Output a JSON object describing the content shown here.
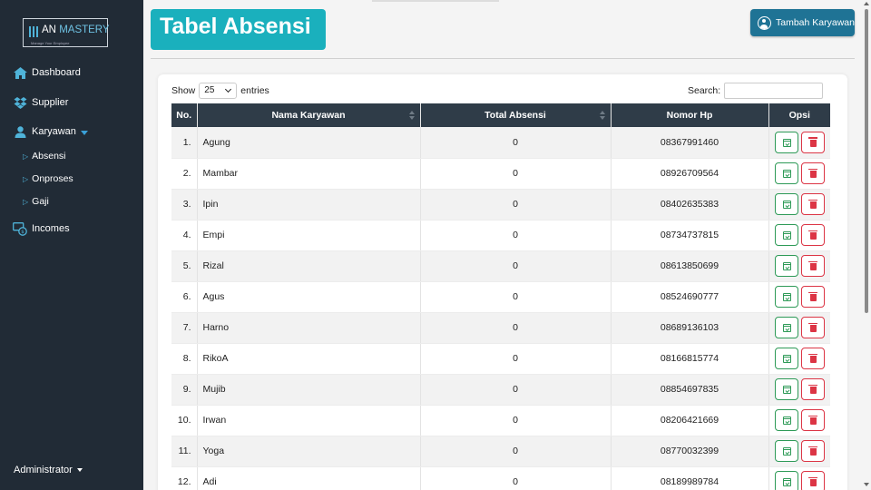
{
  "brand": {
    "name_main": "AN",
    "name_accent": "MASTERY",
    "tagline": "Manage Your Employee"
  },
  "sidebar": {
    "items": [
      {
        "label": "Dashboard",
        "icon": "home-icon"
      },
      {
        "label": "Supplier",
        "icon": "dropbox-icon"
      },
      {
        "label": "Karyawan",
        "icon": "user-icon"
      },
      {
        "label": "Incomes",
        "icon": "money-icon"
      }
    ],
    "sub_items": [
      {
        "label": "Absensi"
      },
      {
        "label": "Onproses"
      },
      {
        "label": "Gaji"
      }
    ],
    "user": "Administrator"
  },
  "header": {
    "title": "Tabel Absensi",
    "add_button": "Tambah Karyawan"
  },
  "table_controls": {
    "show_label": "Show",
    "entries_value": "25",
    "entries_label": "entries",
    "search_label": "Search:",
    "search_value": ""
  },
  "table": {
    "headers": [
      "No.",
      "Nama Karyawan",
      "Total Absensi",
      "Nomor Hp",
      "Opsi"
    ],
    "rows": [
      {
        "no": "1.",
        "name": "Agung",
        "total": "0",
        "hp": "08367991460"
      },
      {
        "no": "2.",
        "name": "Mambar",
        "total": "0",
        "hp": "08926709564"
      },
      {
        "no": "3.",
        "name": "Ipin",
        "total": "0",
        "hp": "08402635383"
      },
      {
        "no": "4.",
        "name": "Empi",
        "total": "0",
        "hp": "08734737815"
      },
      {
        "no": "5.",
        "name": "Rizal",
        "total": "0",
        "hp": "08613850699"
      },
      {
        "no": "6.",
        "name": "Agus",
        "total": "0",
        "hp": "08524690777"
      },
      {
        "no": "7.",
        "name": "Harno",
        "total": "0",
        "hp": "08689136103"
      },
      {
        "no": "8.",
        "name": "RikoA",
        "total": "0",
        "hp": "08166815774"
      },
      {
        "no": "9.",
        "name": "Mujib",
        "total": "0",
        "hp": "08854697835"
      },
      {
        "no": "10.",
        "name": "Irwan",
        "total": "0",
        "hp": "08206421669"
      },
      {
        "no": "11.",
        "name": "Yoga",
        "total": "0",
        "hp": "08770032399"
      },
      {
        "no": "12.",
        "name": "Adi",
        "total": "0",
        "hp": "08189989784"
      }
    ]
  },
  "colors": {
    "sidebar": "#212b36",
    "title_bg": "#1ab0bd",
    "button_bg": "#1f7395",
    "table_header": "#2f3c48",
    "accept": "#2e9a57",
    "delete": "#dc3545"
  }
}
